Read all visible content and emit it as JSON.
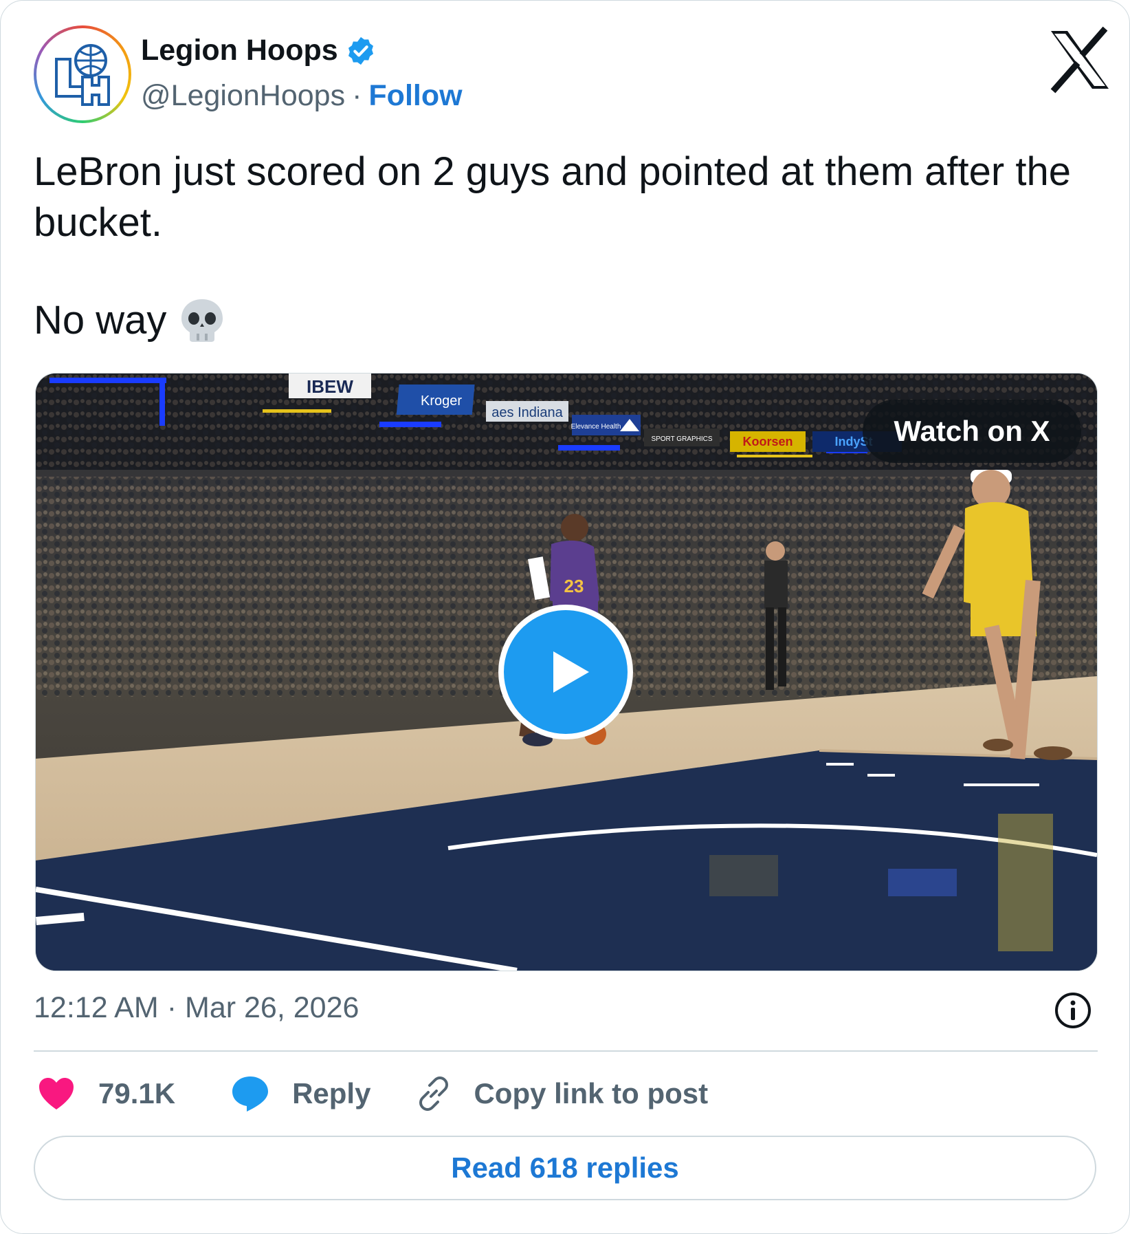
{
  "author": {
    "name": "Legion Hoops",
    "handle": "@LegionHoops",
    "separator": "·",
    "follow_label": "Follow",
    "avatar_monogram": "LH",
    "verified_badge_icon": "verified-badge-icon"
  },
  "post": {
    "text_line1": "LeBron just scored on 2 guys and pointed at them after the bucket.",
    "text_line2": "No way",
    "emoji": "💀"
  },
  "media": {
    "watch_label": "Watch on X",
    "play_icon": "play-icon",
    "jersey_number": "23",
    "banners": [
      "IBEW",
      "Kroger",
      "aes Indiana",
      "Elevance Health",
      "SPORT GRAPHICS",
      "Koorsen",
      "IndySt"
    ]
  },
  "meta": {
    "time": "12:12 AM",
    "separator": "·",
    "date": "Mar 26, 2026",
    "info_icon": "info-icon"
  },
  "actions": {
    "likes": "79.1K",
    "reply_label": "Reply",
    "copy_label": "Copy link to post"
  },
  "read_replies_label": "Read 618 replies",
  "colors": {
    "accent": "#1d78d4",
    "play": "#1d9bf0",
    "like": "#f91880",
    "muted": "#536471"
  }
}
